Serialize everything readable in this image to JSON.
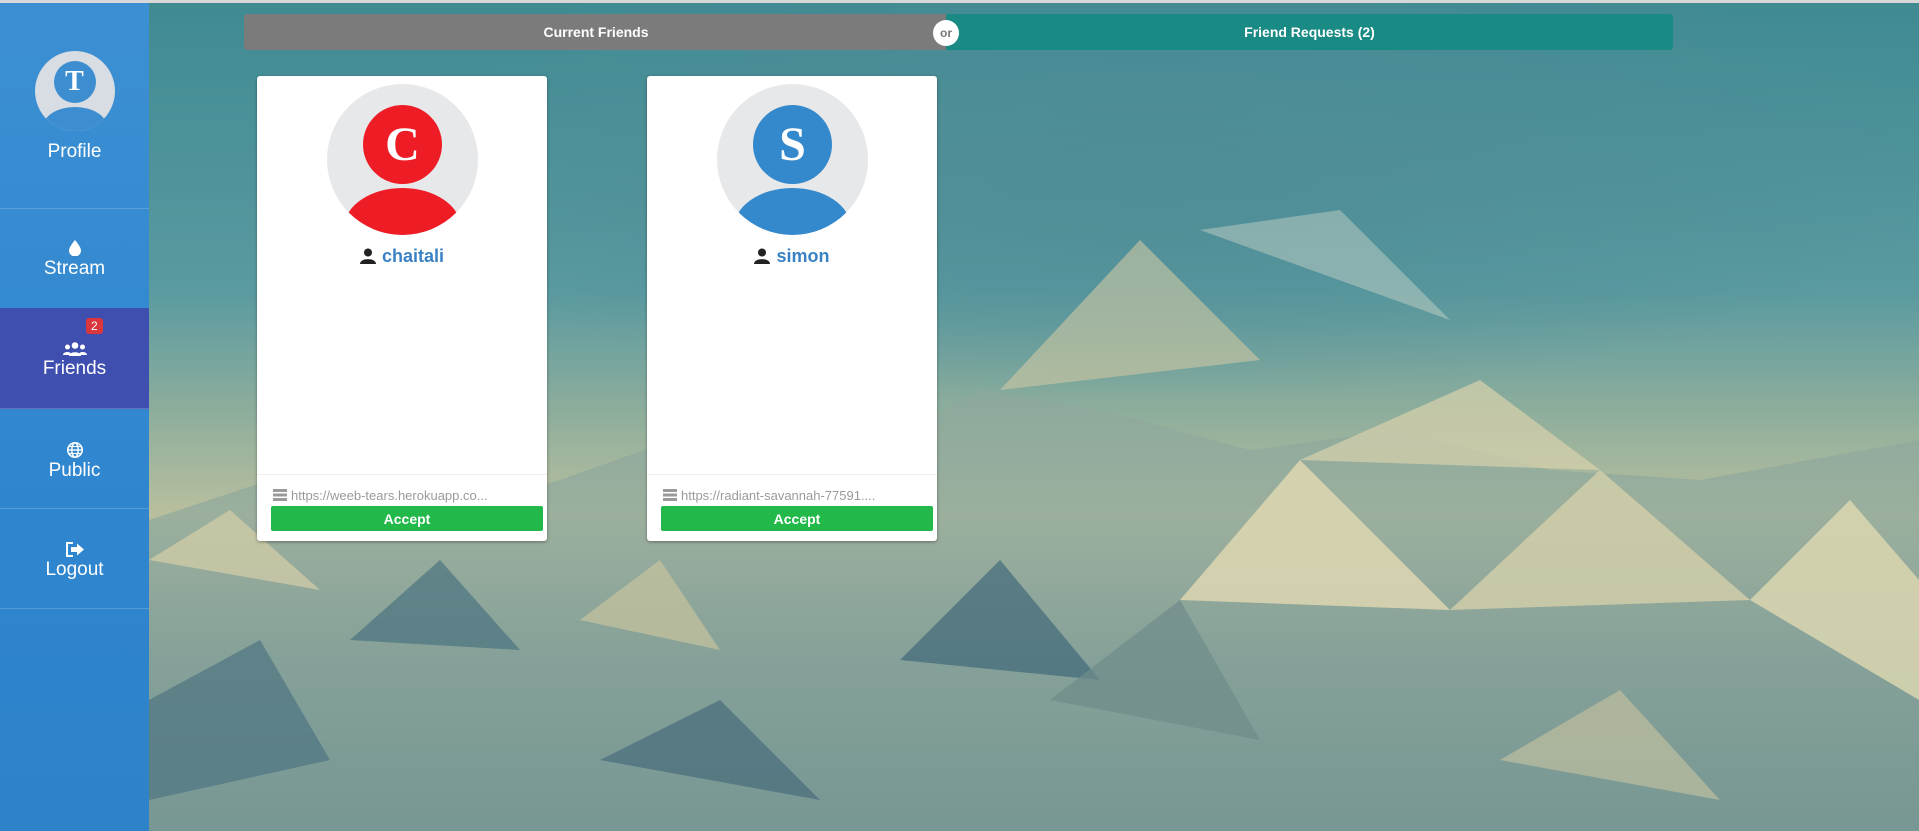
{
  "sidebar": {
    "profile": {
      "initial": "T",
      "label": "Profile"
    },
    "items": [
      {
        "label": "Stream",
        "icon": "drop-icon"
      },
      {
        "label": "Friends",
        "icon": "users-icon",
        "badge": "2"
      },
      {
        "label": "Public",
        "icon": "globe-icon"
      },
      {
        "label": "Logout",
        "icon": "sign-out-icon"
      }
    ]
  },
  "tabs": {
    "current": "Current Friends",
    "or": "or",
    "requests": "Friend Requests (2)"
  },
  "requests": [
    {
      "initial": "C",
      "name": "chaitali",
      "url": "https://weeb-tears.herokuapp.co...",
      "accept": "Accept",
      "color": "#ee1c25"
    },
    {
      "initial": "S",
      "name": "simon",
      "url": "https://radiant-savannah-77591....",
      "accept": "Accept",
      "color": "#3488cc"
    }
  ],
  "colors": {
    "sidebar": "#2f86cf",
    "active": "#3f4fb0",
    "toggle_current": "#7b7b7b",
    "toggle_requests": "#1a8a84",
    "accept": "#22b84a"
  }
}
